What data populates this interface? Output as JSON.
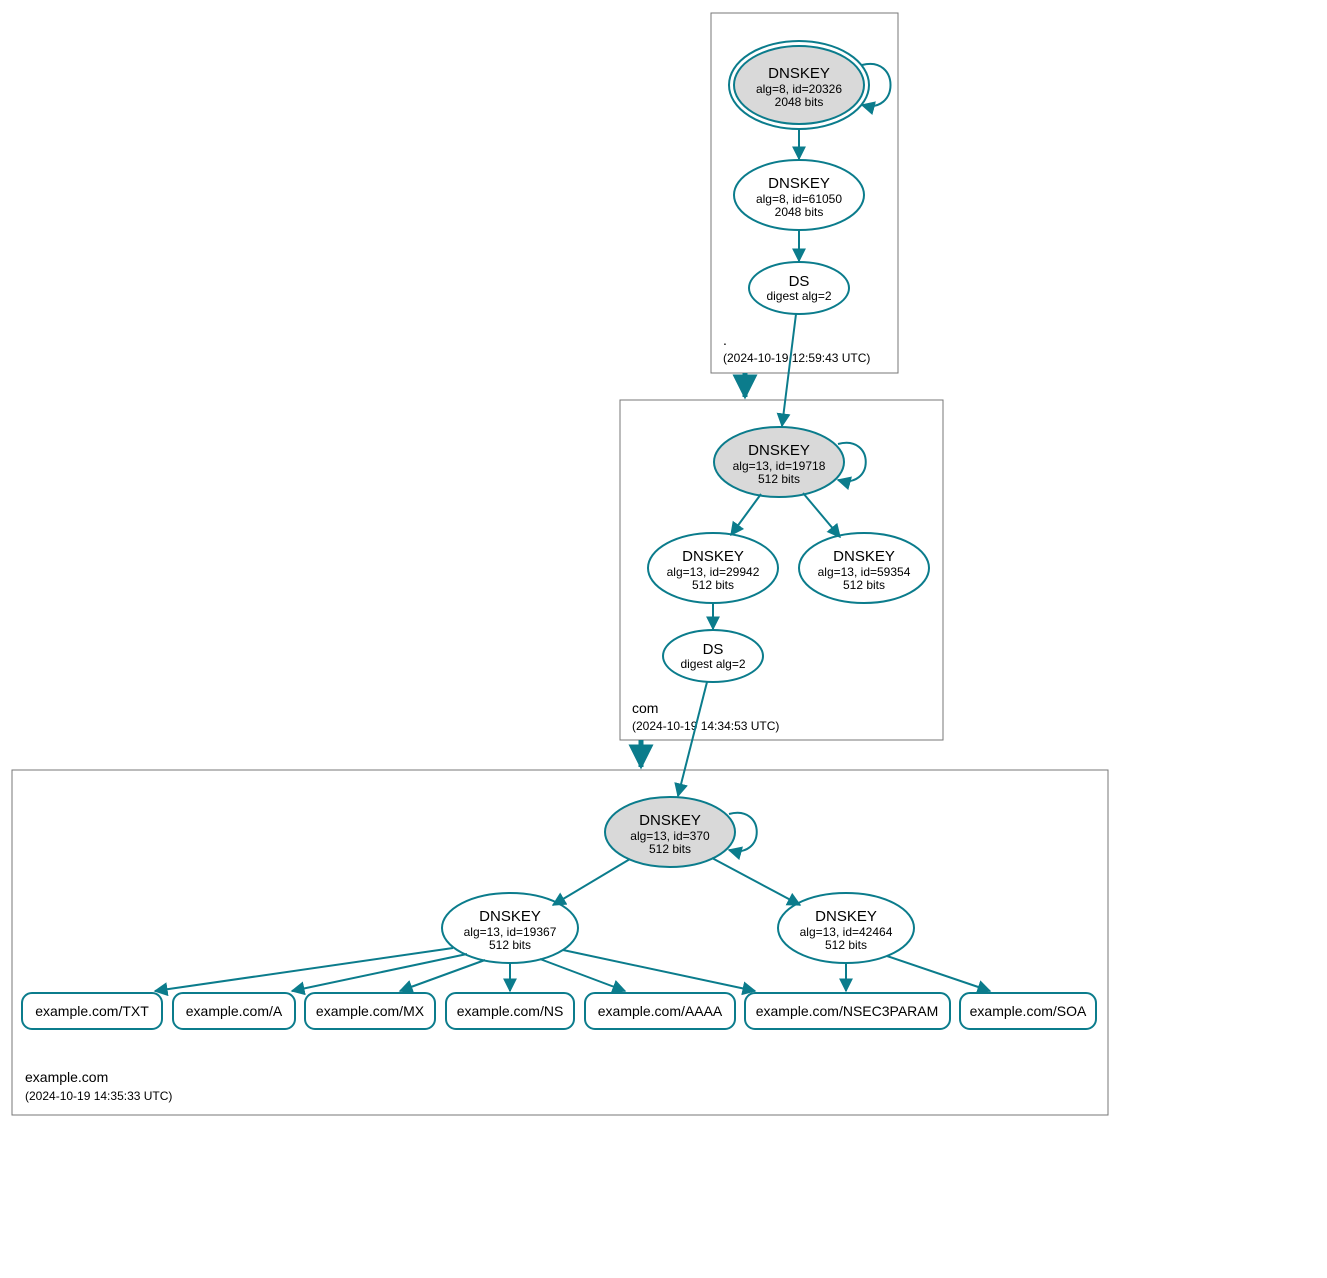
{
  "colors": {
    "accent": "#0b7c8c",
    "fill_gray": "#d9d9d9",
    "box_stroke": "#777777"
  },
  "zones": {
    "root": {
      "label": ".",
      "timestamp": "(2024-10-19 12:59:43 UTC)"
    },
    "com": {
      "label": "com",
      "timestamp": "(2024-10-19 14:34:53 UTC)"
    },
    "example": {
      "label": "example.com",
      "timestamp": "(2024-10-19 14:35:33 UTC)"
    }
  },
  "nodes": {
    "root_ksk": {
      "title": "DNSKEY",
      "line1": "alg=8, id=20326",
      "line2": "2048 bits"
    },
    "root_zsk": {
      "title": "DNSKEY",
      "line1": "alg=8, id=61050",
      "line2": "2048 bits"
    },
    "root_ds": {
      "title": "DS",
      "line1": "digest alg=2"
    },
    "com_ksk": {
      "title": "DNSKEY",
      "line1": "alg=13, id=19718",
      "line2": "512 bits"
    },
    "com_zsk1": {
      "title": "DNSKEY",
      "line1": "alg=13, id=29942",
      "line2": "512 bits"
    },
    "com_zsk2": {
      "title": "DNSKEY",
      "line1": "alg=13, id=59354",
      "line2": "512 bits"
    },
    "com_ds": {
      "title": "DS",
      "line1": "digest alg=2"
    },
    "ex_ksk": {
      "title": "DNSKEY",
      "line1": "alg=13, id=370",
      "line2": "512 bits"
    },
    "ex_zsk1": {
      "title": "DNSKEY",
      "line1": "alg=13, id=19367",
      "line2": "512 bits"
    },
    "ex_zsk2": {
      "title": "DNSKEY",
      "line1": "alg=13, id=42464",
      "line2": "512 bits"
    }
  },
  "records": {
    "txt": "example.com/TXT",
    "a": "example.com/A",
    "mx": "example.com/MX",
    "ns": "example.com/NS",
    "aaaa": "example.com/AAAA",
    "nsec": "example.com/NSEC3PARAM",
    "soa": "example.com/SOA"
  }
}
